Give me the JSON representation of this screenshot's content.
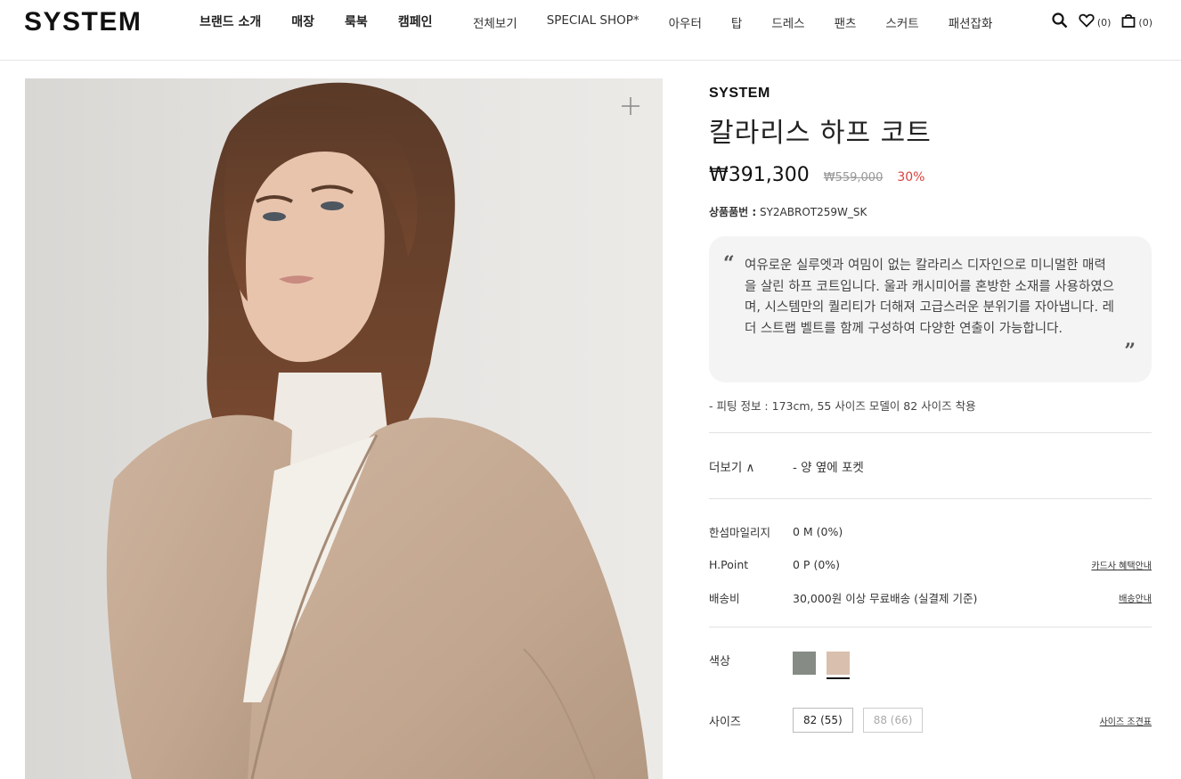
{
  "header": {
    "logo": "SYSTEM",
    "nav_primary": [
      "브랜드 소개",
      "매장",
      "룩북",
      "캠페인"
    ],
    "nav_categories": [
      "전체보기",
      "SPECIAL SHOP*",
      "아우터",
      "탑",
      "드레스",
      "팬츠",
      "스커트",
      "패션잡화"
    ],
    "wishlist_count": "(0)",
    "cart_count": "(0)"
  },
  "product": {
    "brand": "SYSTEM",
    "name": "칼라리스 하프 코트",
    "price": "₩391,300",
    "original_price": "₩559,000",
    "discount": "30%",
    "code_label": "상품품번 :",
    "code_value": "SY2ABROT259W_SK",
    "description": "여유로운 실루엣과 여밈이 없는 칼라리스 디자인으로 미니멀한 매력을 살린 하프 코트입니다. 울과 캐시미어를 혼방한 소재를 사용하였으며, 시스템만의 퀄리티가 더해져 고급스러운 분위기를 자아냅니다. 레더 스트랩 벨트를 함께 구성하여 다양한 연출이 가능합니다.",
    "fit_info": "- 피팅 정보 : 173cm, 55 사이즈 모델이 82 사이즈 착용",
    "more_label": "더보기 ∧",
    "more_text": "- 양 옆에 포켓"
  },
  "benefits": {
    "mileage_label": "한섬마일리지",
    "mileage_value": "0 M (0%)",
    "hpoint_label": "H.Point",
    "hpoint_value": "0 P (0%)",
    "card_link": "카드사 혜택안내",
    "shipping_label": "배송비",
    "shipping_value": "30,000원 이상 무료배송 (실결제 기준)",
    "shipping_link": "배송안내"
  },
  "options": {
    "color_label": "색상",
    "colors": [
      {
        "name": "gray",
        "hex": "#868b86",
        "selected": false
      },
      {
        "name": "beige",
        "hex": "#d9bfae",
        "selected": true
      }
    ],
    "size_label": "사이즈",
    "sizes": [
      {
        "label": "82 (55)",
        "available": true
      },
      {
        "label": "88 (66)",
        "available": false
      }
    ],
    "size_chart_link": "사이즈 조견표"
  }
}
